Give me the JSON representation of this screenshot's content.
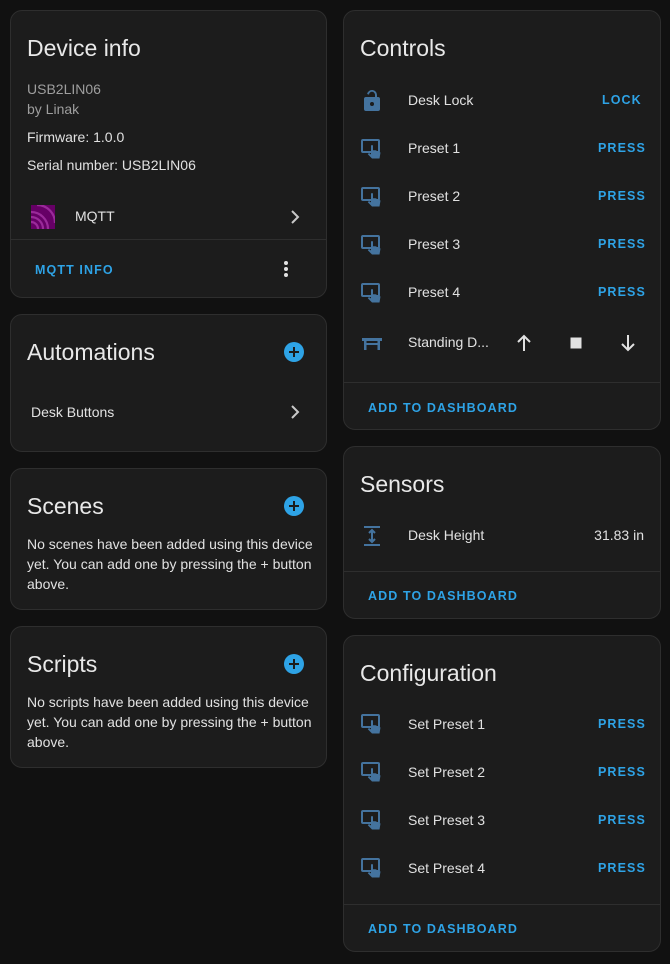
{
  "device_info": {
    "title": "Device info",
    "model": "USB2LIN06",
    "manufacturer": "by Linak",
    "firmware": "Firmware: 1.0.0",
    "serial": "Serial number: USB2LIN06",
    "integration": {
      "label": "MQTT",
      "icon": "mqtt-icon"
    },
    "action_label": "MQTT INFO"
  },
  "automations": {
    "title": "Automations",
    "items": [
      {
        "label": "Desk Buttons"
      }
    ]
  },
  "scenes": {
    "title": "Scenes",
    "empty_text": "No scenes have been added using this device yet. You can add one by pressing the + button above."
  },
  "scripts": {
    "title": "Scripts",
    "empty_text": "No scripts have been added using this device yet. You can add one by pressing the + button above."
  },
  "controls": {
    "title": "Controls",
    "entities": [
      {
        "name": "Desk Lock",
        "icon": "lock-open-icon",
        "action": "LOCK"
      },
      {
        "name": "Preset 1",
        "icon": "gesture-tap-icon",
        "action": "PRESS"
      },
      {
        "name": "Preset 2",
        "icon": "gesture-tap-icon",
        "action": "PRESS"
      },
      {
        "name": "Preset 3",
        "icon": "gesture-tap-icon",
        "action": "PRESS"
      },
      {
        "name": "Preset 4",
        "icon": "gesture-tap-icon",
        "action": "PRESS"
      }
    ],
    "cover": {
      "name": "Standing D...",
      "icon": "desk-icon"
    },
    "footer": "ADD TO DASHBOARD"
  },
  "sensors": {
    "title": "Sensors",
    "entities": [
      {
        "name": "Desk Height",
        "value": "31.83 in",
        "icon": "arrow-expand-vertical-icon"
      }
    ],
    "footer": "ADD TO DASHBOARD"
  },
  "configuration": {
    "title": "Configuration",
    "entities": [
      {
        "name": "Set Preset 1",
        "action": "PRESS",
        "icon": "gesture-tap-icon"
      },
      {
        "name": "Set Preset 2",
        "action": "PRESS",
        "icon": "gesture-tap-icon"
      },
      {
        "name": "Set Preset 3",
        "action": "PRESS",
        "icon": "gesture-tap-icon"
      },
      {
        "name": "Set Preset 4",
        "action": "PRESS",
        "icon": "gesture-tap-icon"
      }
    ],
    "footer": "ADD TO DASHBOARD"
  },
  "colors": {
    "accent": "#2ea3e6",
    "icon": "#44739e",
    "mqtt": "#660066"
  }
}
